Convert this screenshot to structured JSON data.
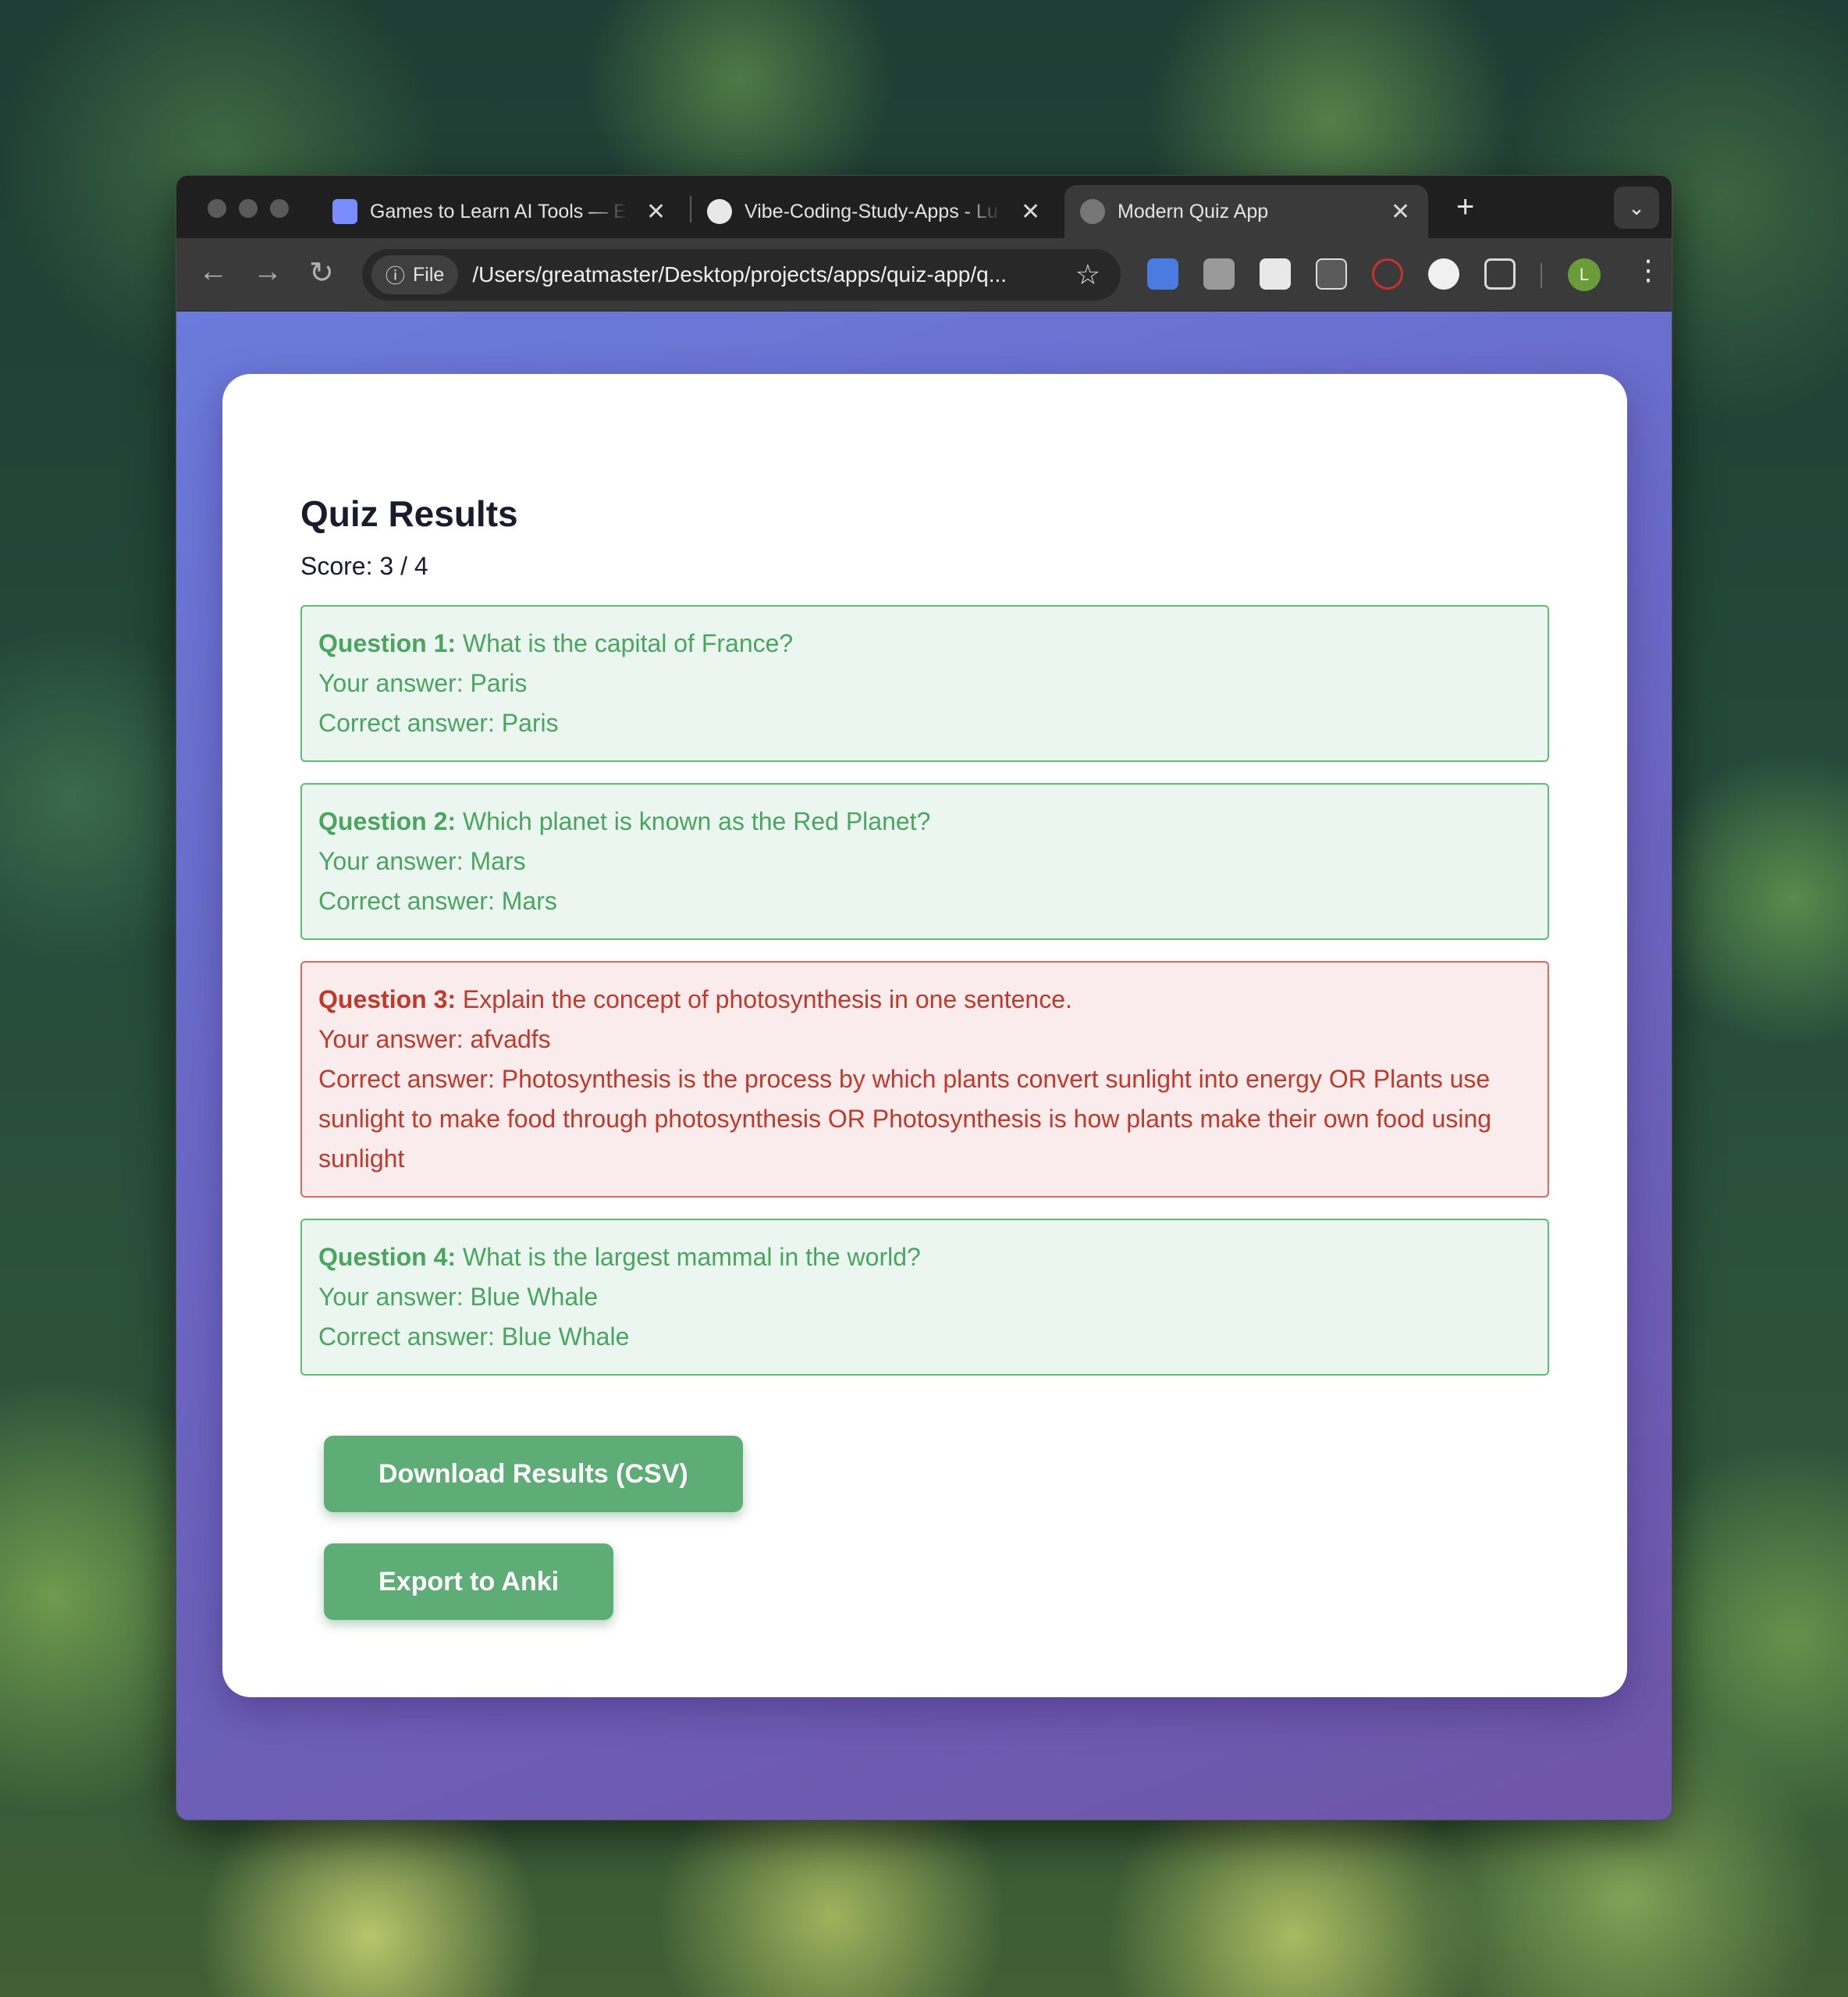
{
  "browser": {
    "tabs": [
      {
        "title": "Games to Learn AI Tools — Ex"
      },
      {
        "title": "Vibe-Coding-Study-Apps - Lu"
      },
      {
        "title": "Modern Quiz App"
      }
    ],
    "new_tab_label": "+",
    "close_glyph": "✕",
    "address": {
      "chip_label": "File",
      "url": "/Users/greatmaster/Desktop/projects/apps/quiz-app/q..."
    },
    "avatar_letter": "L",
    "icons": {
      "back": "←",
      "forward": "→",
      "reload": "↻",
      "star": "☆",
      "kebab": "⋮",
      "tab_menu": "⌄",
      "info": "ⓘ"
    }
  },
  "quiz": {
    "title": "Quiz Results",
    "score": "Score: 3 / 4",
    "results": [
      {
        "status": "correct",
        "label": "Question 1:",
        "question": " What is the capital of France?",
        "your_answer": "Your answer: Paris",
        "correct_answer": "Correct answer: Paris"
      },
      {
        "status": "correct",
        "label": "Question 2:",
        "question": " Which planet is known as the Red Planet?",
        "your_answer": "Your answer: Mars",
        "correct_answer": "Correct answer: Mars"
      },
      {
        "status": "wrong",
        "label": "Question 3:",
        "question": " Explain the concept of photosynthesis in one sentence.",
        "your_answer": "Your answer: afvadfs",
        "correct_answer": "Correct answer: Photosynthesis is the process by which plants convert sunlight into energy OR Plants use sunlight to make food through photosynthesis OR Photosynthesis is how plants make their own food using sunlight"
      },
      {
        "status": "correct",
        "label": "Question 4:",
        "question": " What is the largest mammal in the world?",
        "your_answer": "Your answer: Blue Whale",
        "correct_answer": "Correct answer: Blue Whale"
      }
    ],
    "download_button": "Download Results (CSV)",
    "anki_button": "Export to Anki"
  },
  "colors": {
    "correct_bg": "#ebf6f1",
    "correct_text": "#4aa55e",
    "wrong_bg": "#faecec",
    "wrong_text": "#c0392b",
    "button": "#5fad76"
  }
}
